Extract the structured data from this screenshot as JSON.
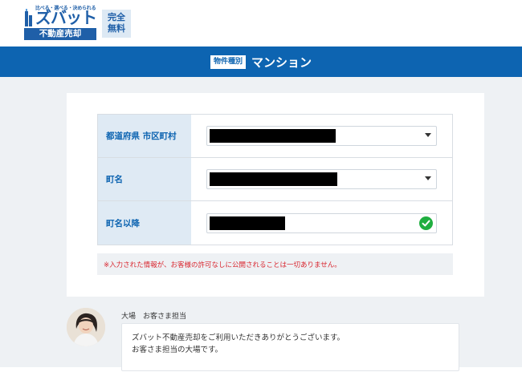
{
  "header": {
    "logo": {
      "tagline": "比べる・選べる・決められる",
      "name": "ズバット",
      "sub": "不動産売却"
    },
    "free_badge": [
      "完全",
      "無料"
    ]
  },
  "banner": {
    "type_tag": "物件種別",
    "type_value": "マンション"
  },
  "form": {
    "rows": [
      {
        "label": "都道府県 市区町村",
        "control": "select",
        "value_redacted": true
      },
      {
        "label": "町名",
        "control": "select",
        "value_redacted": true
      },
      {
        "label": "町名以降",
        "control": "text",
        "value_redacted": true,
        "status_icon": "check-icon"
      }
    ],
    "notice": "※入力された情報が、お客様の許可なしに公開されることは一切ありません。"
  },
  "chat": {
    "agent_name": "大場　お客さま担当",
    "messages": [
      "ズバット不動産売却をご利用いただきありがとうございます。",
      "お客さま担当の大場です。"
    ]
  },
  "colors": {
    "brand_blue": "#0d64b1",
    "label_bg": "#dfeaf4",
    "notice_red": "#d9262f",
    "check_green": "#1fae3f",
    "page_bg": "#eef1f4"
  }
}
